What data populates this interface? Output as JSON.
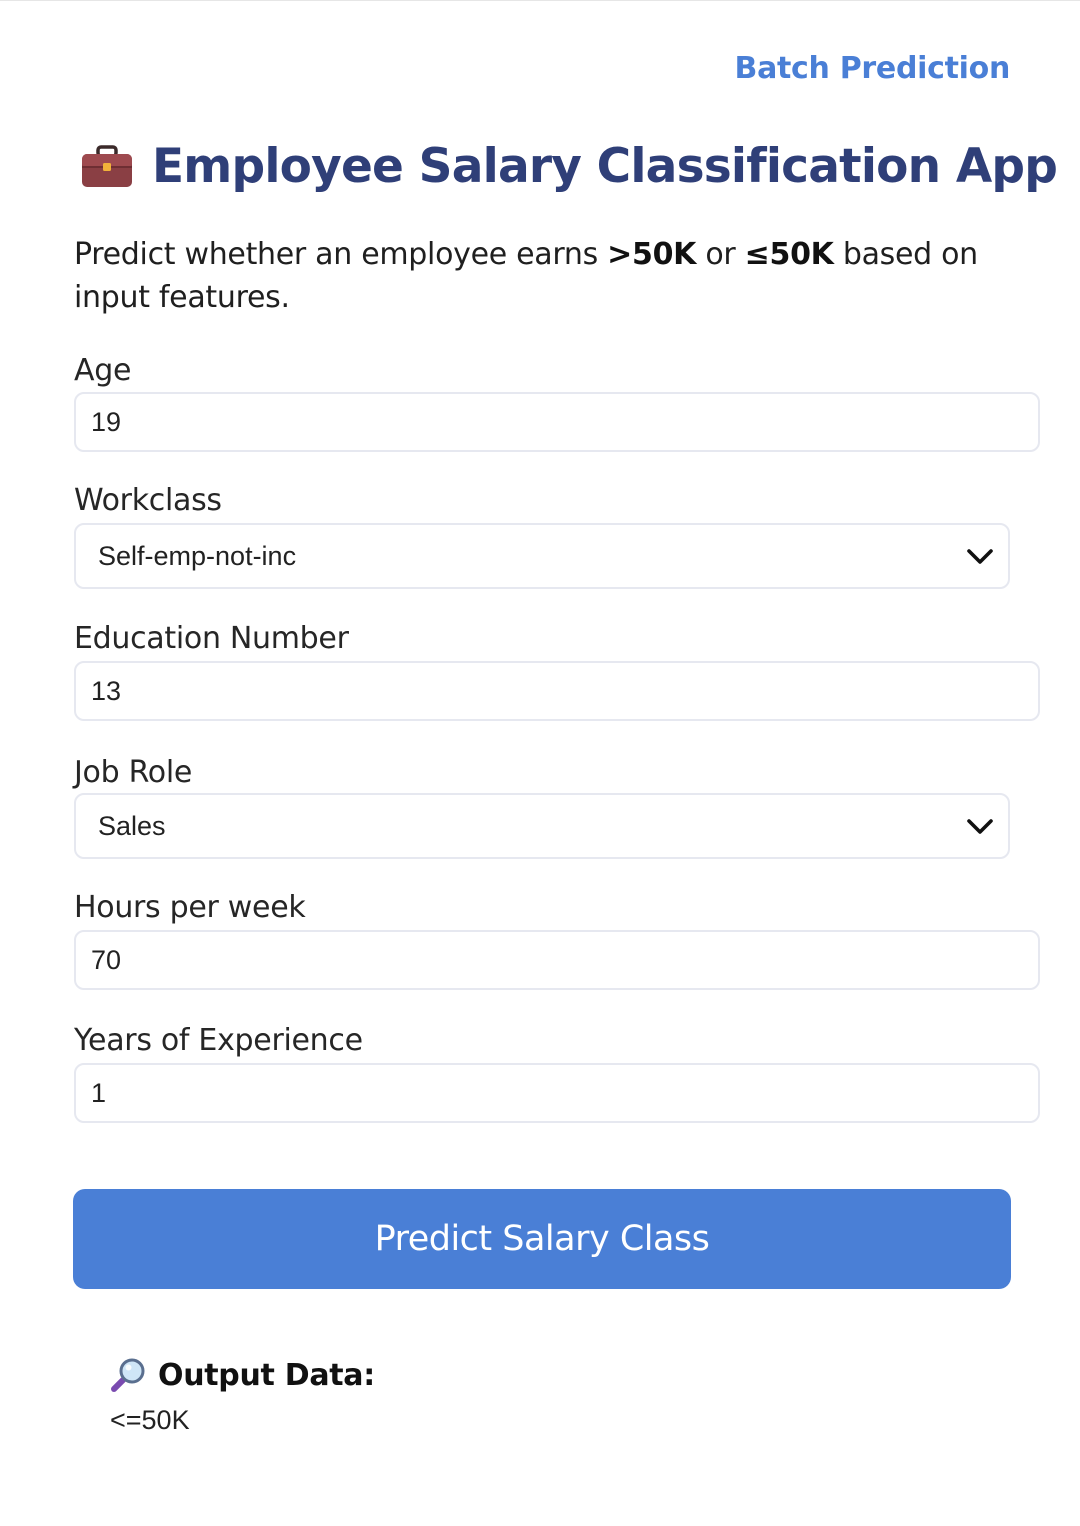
{
  "header": {
    "batch_link": "Batch Prediction",
    "title": "Employee Salary Classification App",
    "title_icon": "briefcase-icon",
    "subtitle_pre": "Predict whether an employee earns ",
    "subtitle_gt": ">50K",
    "subtitle_mid": " or ",
    "subtitle_le": "≤50K",
    "subtitle_post": " based on input features."
  },
  "form": {
    "age": {
      "label": "Age",
      "value": "19"
    },
    "workclass": {
      "label": "Workclass",
      "value": "Self-emp-not-inc"
    },
    "education_number": {
      "label": "Education Number",
      "value": "13"
    },
    "job_role": {
      "label": "Job Role",
      "value": "Sales"
    },
    "hours_per_week": {
      "label": "Hours per week",
      "value": "70"
    },
    "experience": {
      "label": "Years of Experience",
      "value": "1"
    }
  },
  "action": {
    "predict_label": "Predict Salary Class"
  },
  "output": {
    "icon": "magnifying-glass-icon",
    "title": "Output Data:",
    "value": "<=50K"
  },
  "colors": {
    "accent": "#4a7fd6",
    "title": "#2f3f78"
  }
}
